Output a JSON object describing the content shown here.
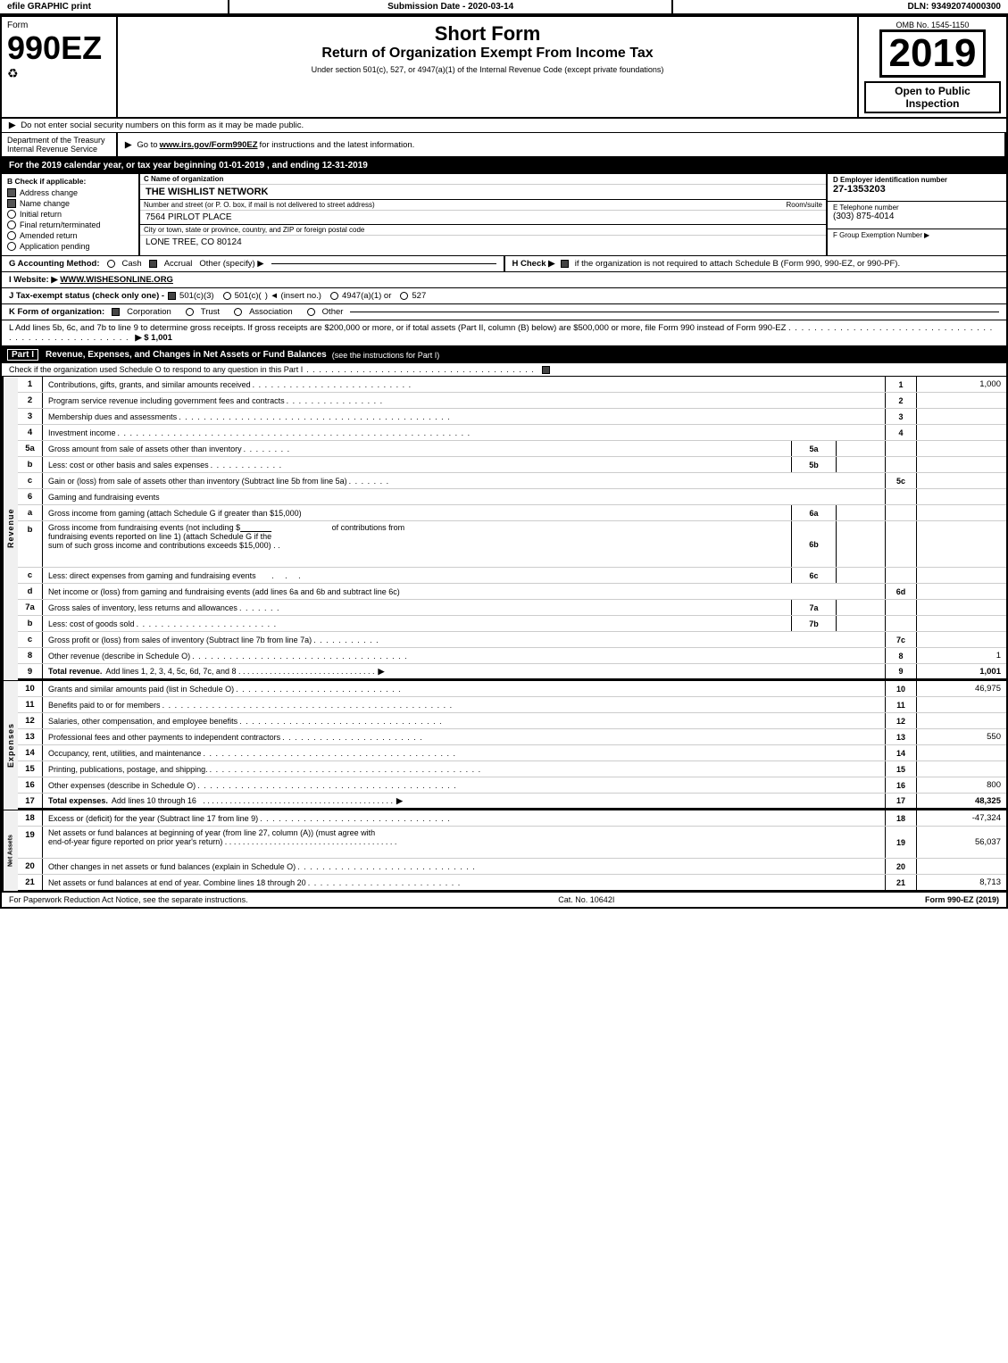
{
  "topStrip": {
    "left": "efile GRAPHIC print",
    "mid": "Submission Date - 2020-03-14",
    "right": "DLN: 93492074000300"
  },
  "form": {
    "number": "990EZ",
    "label": "Form",
    "icon": "♻",
    "shortFormTitle": "Short Form",
    "returnTitle": "Return of Organization Exempt From Income Tax",
    "underTitle": "Under section 501(c), 527, or 4947(a)(1) of the Internal Revenue Code (except private foundations)",
    "notice1": "Do not enter social security numbers on this form as it may be made public.",
    "notice2": "Go to www.irs.gov/Form990EZ for instructions and the latest information.",
    "notice2Link": "www.irs.gov/Form990EZ",
    "year": "2019",
    "ombNo": "OMB No. 1545-1150",
    "openPublic": "Open to Public Inspection",
    "deptLabel": "Department of the Treasury",
    "irsLabel": "Internal Revenue Service",
    "yearRow": "For the 2019 calendar year, or tax year beginning 01-01-2019 , and ending 12-31-2019"
  },
  "checkSection": {
    "bLabel": "B Check if applicable:",
    "addressChange": "Address change",
    "nameChange": "Name change",
    "initialReturn": "Initial return",
    "finalReturn": "Final return/terminated",
    "amendedReturn": "Amended return",
    "applicationPending": "Application pending",
    "addressChecked": true,
    "nameChecked": true,
    "initialChecked": false,
    "finalChecked": false,
    "amendedChecked": false,
    "appChecked": false
  },
  "orgInfo": {
    "cLabel": "C Name of organization",
    "orgName": "THE WISHLIST NETWORK",
    "addrLabel": "Number and street (or P. O. box, if mail is not delivered to street address)",
    "suiteLabel": "Room/suite",
    "street": "7564 PIRLOT PLACE",
    "cityLabel": "City or town, state or province, country, and ZIP or foreign postal code",
    "city": "LONE TREE, CO  80124",
    "dLabel": "D Employer identification number",
    "ein": "27-1353203",
    "eLabel": "E Telephone number",
    "tel": "(303) 875-4014",
    "fLabel": "F Group Exemption Number",
    "fArrow": "▶"
  },
  "sectionG": {
    "label": "G Accounting Method:",
    "cashLabel": "Cash",
    "accrualLabel": "Accrual",
    "otherLabel": "Other (specify) ▶",
    "accrualChecked": true,
    "cashChecked": false
  },
  "sectionH": {
    "text": "H  Check ▶",
    "checkLabel": "if the organization is not required to attach Schedule B (Form 990, 990-EZ, or 990-PF).",
    "checked": true
  },
  "website": {
    "label": "I Website: ▶",
    "url": "WWW.WISHESONLINE.ORG"
  },
  "taxStatus": {
    "label": "J Tax-exempt status (check only one) -",
    "options": [
      "501(c)(3)",
      "501(c)(",
      "  ) ◄ (insert no.)",
      "4947(a)(1) or",
      "527"
    ],
    "checked501c3": true
  },
  "kRow": {
    "label": "K Form of organization:",
    "options": [
      "Corporation",
      "Trust",
      "Association",
      "Other"
    ],
    "corporationChecked": true
  },
  "lRow": {
    "text": "L Add lines 5b, 6c, and 7b to line 9 to determine gross receipts. If gross receipts are $200,000 or more, or if total assets (Part II, column (B) below) are $500,000 or more, file Form 990 instead of Form 990-EZ",
    "dots": ". . . . . . . . . . . . . . . . . . . . . . . . . . . . . . . . . . . . . . . . . . . . . . . . . . .",
    "arrow": "▶ $ 1,001"
  },
  "partI": {
    "label": "Part I",
    "title": "Revenue, Expenses, and Changes in Net Assets or Fund Balances",
    "titleNote": "(see the instructions for Part I)",
    "scheduleCheck": "Check if the organization used Schedule O to respond to any question in this Part I",
    "scheduleCheckDots": ". . . . . . . . . . . . . . . . . . . . . . . . . . . . . . . . . . . . .",
    "scheduleChecked": true
  },
  "revenueRows": [
    {
      "num": "1",
      "desc": "Contributions, gifts, grants, and similar amounts received",
      "dots": ". . . . . . . . . . . . . . . . . . . . . . . . . .",
      "lineNum": "1",
      "val": "1,000"
    },
    {
      "num": "2",
      "desc": "Program service revenue including government fees and contracts",
      "dots": ". . . . . . . . . . . . . . . .",
      "lineNum": "2",
      "val": ""
    },
    {
      "num": "3",
      "desc": "Membership dues and assessments",
      "dots": ". . . . . . . . . . . . . . . . . . . . . . . . . . . . . . . . . . . . . . . . . . . .",
      "lineNum": "3",
      "val": ""
    },
    {
      "num": "4",
      "desc": "Investment income",
      "dots": ". . . . . . . . . . . . . . . . . . . . . . . . . . . . . . . . . . . . . . . . . . . . . . . . . . . . . . . . .",
      "lineNum": "4",
      "val": ""
    },
    {
      "num": "5a",
      "desc": "Gross amount from sale of assets other than inventory",
      "dots": ". . . . . . . .",
      "subLine": "5a",
      "lineNum": "",
      "val": ""
    },
    {
      "num": "b",
      "desc": "Less: cost or other basis and sales expenses",
      "dots": ". . . . . . . . . . . .",
      "subLine": "5b",
      "lineNum": "",
      "val": ""
    },
    {
      "num": "c",
      "desc": "Gain or (loss) from sale of assets other than inventory (Subtract line 5b from line 5a)",
      "dots": ". . . . . . .",
      "lineNum": "5c",
      "val": ""
    },
    {
      "num": "6",
      "desc": "Gaming and fundraising events",
      "dots": "",
      "lineNum": "",
      "val": ""
    },
    {
      "num": "a",
      "desc": "Gross income from gaming (attach Schedule G if greater than $15,000)",
      "dots": "",
      "subLine": "6a",
      "lineNum": "",
      "val": ""
    },
    {
      "num": "b",
      "desc": "Gross income from fundraising events (not including $_____ of contributions from fundraising events reported on line 1) (attach Schedule G if the sum of such gross income and contributions exceeds $15,000)",
      "dots": "   . .",
      "subLine": "6b",
      "lineNum": "",
      "val": ""
    },
    {
      "num": "c",
      "desc": "Less: direct expenses from gaming and fundraising events",
      "dots": "   .   .   .",
      "subLine": "6c",
      "lineNum": "",
      "val": ""
    },
    {
      "num": "d",
      "desc": "Net income or (loss) from gaming and fundraising events (add lines 6a and 6b and subtract line 6c)",
      "dots": "",
      "lineNum": "6d",
      "val": ""
    },
    {
      "num": "7a",
      "desc": "Gross sales of inventory, less returns and allowances",
      "dots": ". . . . . . .",
      "subLine": "7a",
      "lineNum": "",
      "val": ""
    },
    {
      "num": "b",
      "desc": "Less: cost of goods sold",
      "dots": ". . . . . . . . . . . . . . . . . . . . . . .",
      "subLine": "7b",
      "lineNum": "",
      "val": ""
    },
    {
      "num": "c",
      "desc": "Gross profit or (loss) from sales of inventory (Subtract line 7b from line 7a)",
      "dots": ". . . . . . . . . . .",
      "lineNum": "7c",
      "val": ""
    },
    {
      "num": "8",
      "desc": "Other revenue (describe in Schedule O)",
      "dots": ". . . . . . . . . . . . . . . . . . . . . . . . . . . . . . . . . . .",
      "lineNum": "8",
      "val": "1"
    },
    {
      "num": "9",
      "desc": "Total revenue. Add lines 1, 2, 3, 4, 5c, 6d, 7c, and 8",
      "dots": ". . . . . . . . . . . . . . . . . . . . . . . . . . . . . . .",
      "arrow": "▶",
      "lineNum": "9",
      "val": "1,001",
      "bold": true
    }
  ],
  "expenseRows": [
    {
      "num": "10",
      "desc": "Grants and similar amounts paid (list in Schedule O)",
      "dots": ". . . . . . . . . . . . . . . . . . . . . . . . . . .",
      "lineNum": "10",
      "val": "46,975"
    },
    {
      "num": "11",
      "desc": "Benefits paid to or for members",
      "dots": ". . . . . . . . . . . . . . . . . . . . . . . . . . . . . . . . . . . . . . . . . . . . . . .",
      "lineNum": "11",
      "val": ""
    },
    {
      "num": "12",
      "desc": "Salaries, other compensation, and employee benefits",
      "dots": ". . . . . . . . . . . . . . . . . . . . . . . . . . . . . . . . .",
      "lineNum": "12",
      "val": ""
    },
    {
      "num": "13",
      "desc": "Professional fees and other payments to independent contractors",
      "dots": ". . . . . . . . . . . . . . . . . . . . . . .",
      "lineNum": "13",
      "val": "550"
    },
    {
      "num": "14",
      "desc": "Occupancy, rent, utilities, and maintenance",
      "dots": ". . . . . . . . . . . . . . . . . . . . . . . . . . . . . . . . . . . . . . . . .",
      "lineNum": "14",
      "val": ""
    },
    {
      "num": "15",
      "desc": "Printing, publications, postage, and shipping.",
      "dots": ". . . . . . . . . . . . . . . . . . . . . . . . . . . . . . . . . . . . . . . . . . . .",
      "lineNum": "15",
      "val": ""
    },
    {
      "num": "16",
      "desc": "Other expenses (describe in Schedule O)",
      "dots": ". . . . . . . . . . . . . . . . . . . . . . . . . . . . . . . . . . . . . . . . . .",
      "lineNum": "16",
      "val": "800"
    },
    {
      "num": "17",
      "desc": "Total expenses. Add lines 10 through 16",
      "dots": ". . . . . . . . . . . . . . . . . . . . . . . . . . . . . . . . . . . . . . . . . . .",
      "arrow": "▶",
      "lineNum": "17",
      "val": "48,325",
      "bold": true
    }
  ],
  "netAssetRows": [
    {
      "num": "18",
      "desc": "Excess or (deficit) for the year (Subtract line 17 from line 9)",
      "dots": ". . . . . . . . . . . . . . . . . . . . . . . . . . . . . . .",
      "lineNum": "18",
      "val": "-47,324"
    },
    {
      "num": "19",
      "desc": "Net assets or fund balances at beginning of year (from line 27, column (A)) (must agree with end-of-year figure reported on prior year's return)",
      "dots": ". . . . . . . . . . . . . . . . . . . . . . . . . . . . . . . . . . . . . . .",
      "lineNum": "19",
      "val": "56,037"
    },
    {
      "num": "20",
      "desc": "Other changes in net assets or fund balances (explain in Schedule O)",
      "dots": ". . . . . . . . . . . . . . . . . . . . . . . . . . . . .",
      "lineNum": "20",
      "val": ""
    },
    {
      "num": "21",
      "desc": "Net assets or fund balances at end of year. Combine lines 18 through 20",
      "dots": ". . . . . . . . . . . . . . . . . . . . . . . . .",
      "lineNum": "21",
      "val": "8,713"
    }
  ],
  "footer": {
    "left": "For Paperwork Reduction Act Notice, see the separate instructions.",
    "mid": "Cat. No. 10642I",
    "right": "Form 990-EZ (2019)"
  }
}
